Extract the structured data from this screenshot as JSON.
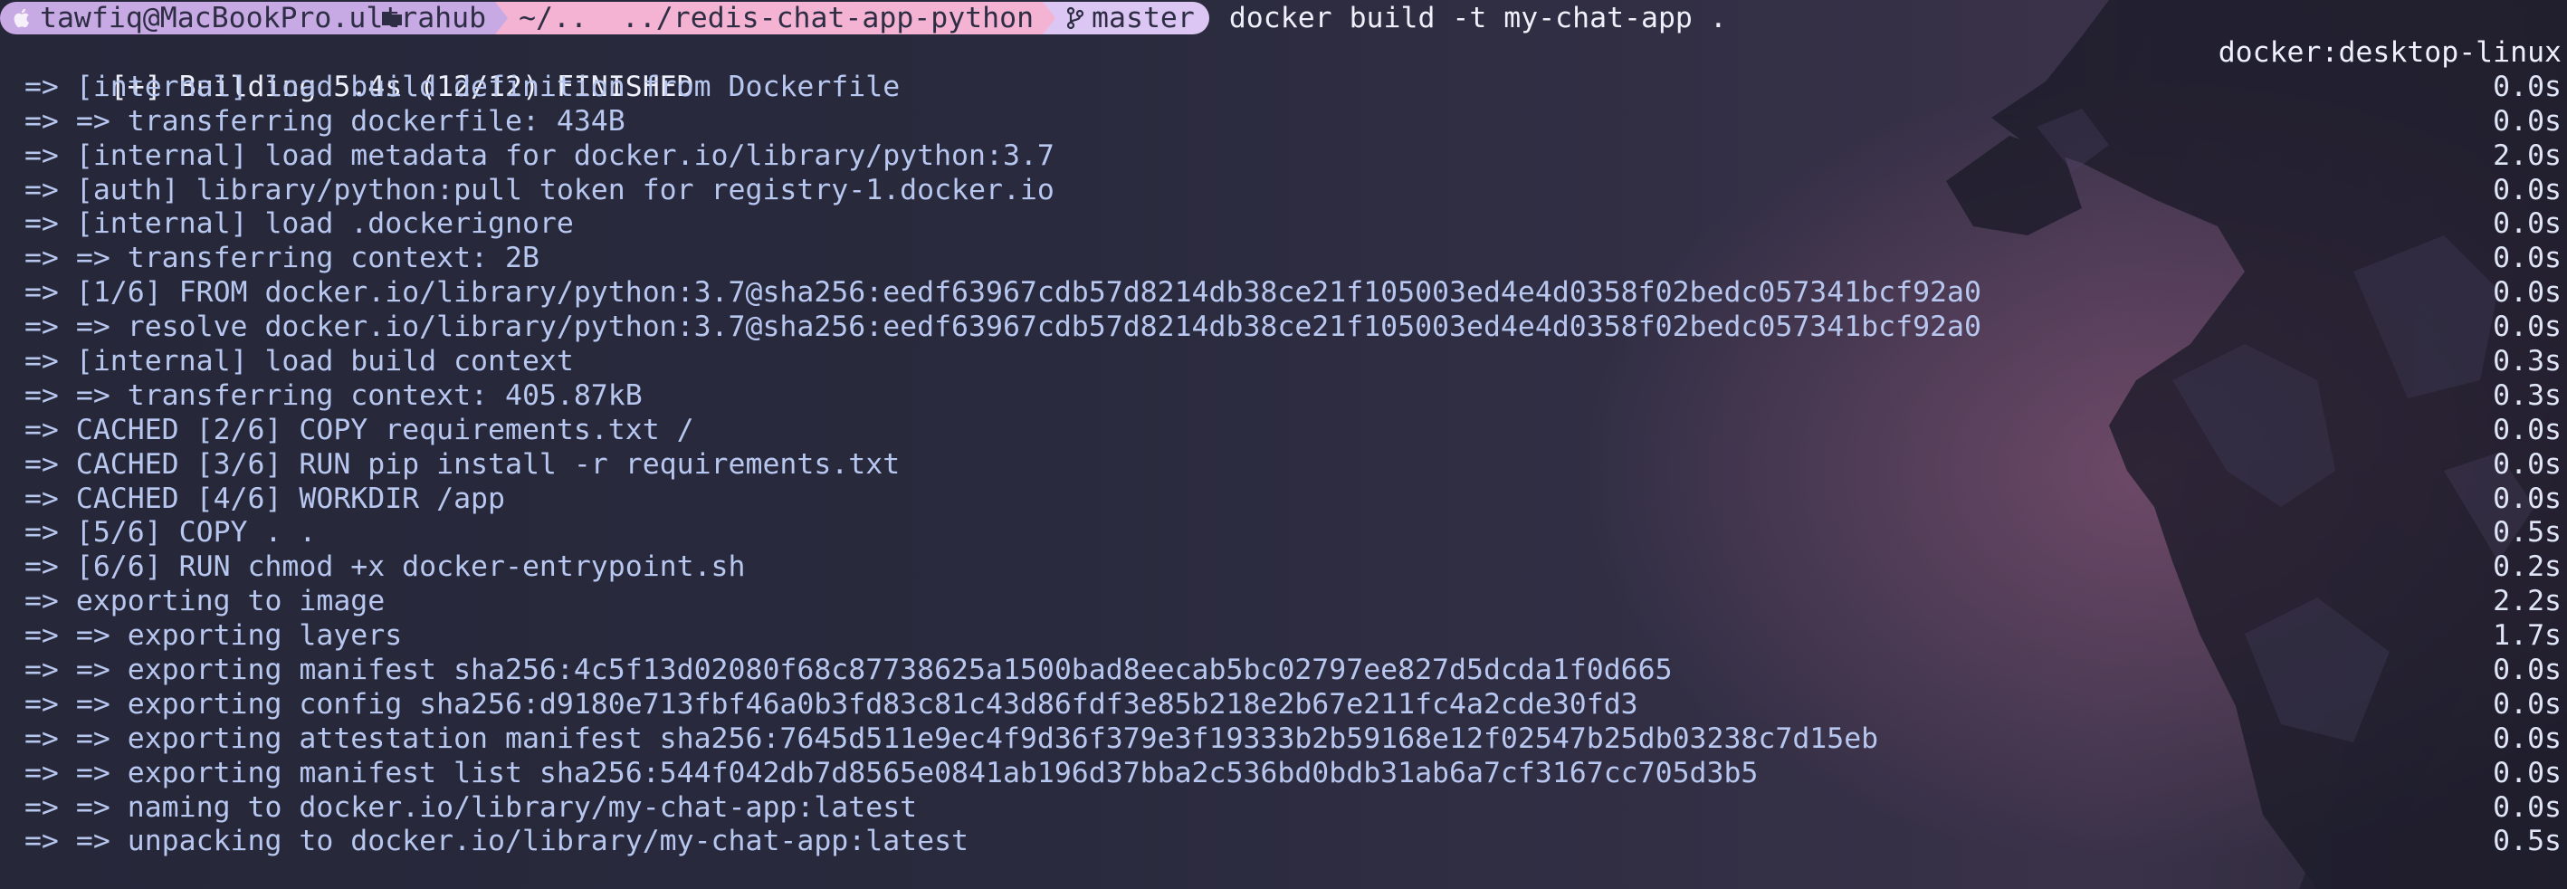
{
  "prompt": {
    "user_host": "tawfiq@MacBookPro.ultrahub",
    "path": "~/..  ../redis-chat-app-python",
    "branch": "master",
    "command": "docker build -t my-chat-app ."
  },
  "output": {
    "header": {
      "text": "[+] Building 5.4s (12/12) FINISHED",
      "right": "docker:desktop-linux"
    },
    "lines": [
      {
        "text": " => [internal] load build definition from Dockerfile",
        "time": "0.0s"
      },
      {
        "text": " => => transferring dockerfile: 434B",
        "time": "0.0s"
      },
      {
        "text": " => [internal] load metadata for docker.io/library/python:3.7",
        "time": "2.0s"
      },
      {
        "text": " => [auth] library/python:pull token for registry-1.docker.io",
        "time": "0.0s"
      },
      {
        "text": " => [internal] load .dockerignore",
        "time": "0.0s"
      },
      {
        "text": " => => transferring context: 2B",
        "time": "0.0s"
      },
      {
        "text": " => [1/6] FROM docker.io/library/python:3.7@sha256:eedf63967cdb57d8214db38ce21f105003ed4e4d0358f02bedc057341bcf92a0",
        "time": "0.0s"
      },
      {
        "text": " => => resolve docker.io/library/python:3.7@sha256:eedf63967cdb57d8214db38ce21f105003ed4e4d0358f02bedc057341bcf92a0",
        "time": "0.0s"
      },
      {
        "text": " => [internal] load build context",
        "time": "0.3s"
      },
      {
        "text": " => => transferring context: 405.87kB",
        "time": "0.3s"
      },
      {
        "text": " => CACHED [2/6] COPY requirements.txt /",
        "time": "0.0s"
      },
      {
        "text": " => CACHED [3/6] RUN pip install -r requirements.txt",
        "time": "0.0s"
      },
      {
        "text": " => CACHED [4/6] WORKDIR /app",
        "time": "0.0s"
      },
      {
        "text": " => [5/6] COPY . .",
        "time": "0.5s"
      },
      {
        "text": " => [6/6] RUN chmod +x docker-entrypoint.sh",
        "time": "0.2s"
      },
      {
        "text": " => exporting to image",
        "time": "2.2s"
      },
      {
        "text": " => => exporting layers",
        "time": "1.7s"
      },
      {
        "text": " => => exporting manifest sha256:4c5f13d02080f68c87738625a1500bad8eecab5bc02797ee827d5dcda1f0d665",
        "time": "0.0s"
      },
      {
        "text": " => => exporting config sha256:d9180e713fbf46a0b3fd83c81c43d86fdf3e85b218e2b67e211fc4a2cde30fd3",
        "time": "0.0s"
      },
      {
        "text": " => => exporting attestation manifest sha256:7645d511e9ec4f9d36f379e3f19333b2b59168e12f02547b25db03238c7d15eb",
        "time": "0.0s"
      },
      {
        "text": " => => exporting manifest list sha256:544f042db7d8565e0841ab196d37bba2c536bd0bdb31ab6a7cf3167cc705d3b5",
        "time": "0.0s"
      },
      {
        "text": " => => naming to docker.io/library/my-chat-app:latest",
        "time": "0.0s"
      },
      {
        "text": " => => unpacking to docker.io/library/my-chat-app:latest",
        "time": "0.5s"
      }
    ]
  },
  "colors": {
    "segment_user": "#c7a9e4",
    "segment_path": "#f4b3d3",
    "segment_git": "#dcc6f3",
    "output_text": "#b7c7ef",
    "background": "#292a3d"
  },
  "icons": [
    "apple-icon",
    "folder-icon",
    "git-branch-icon"
  ]
}
